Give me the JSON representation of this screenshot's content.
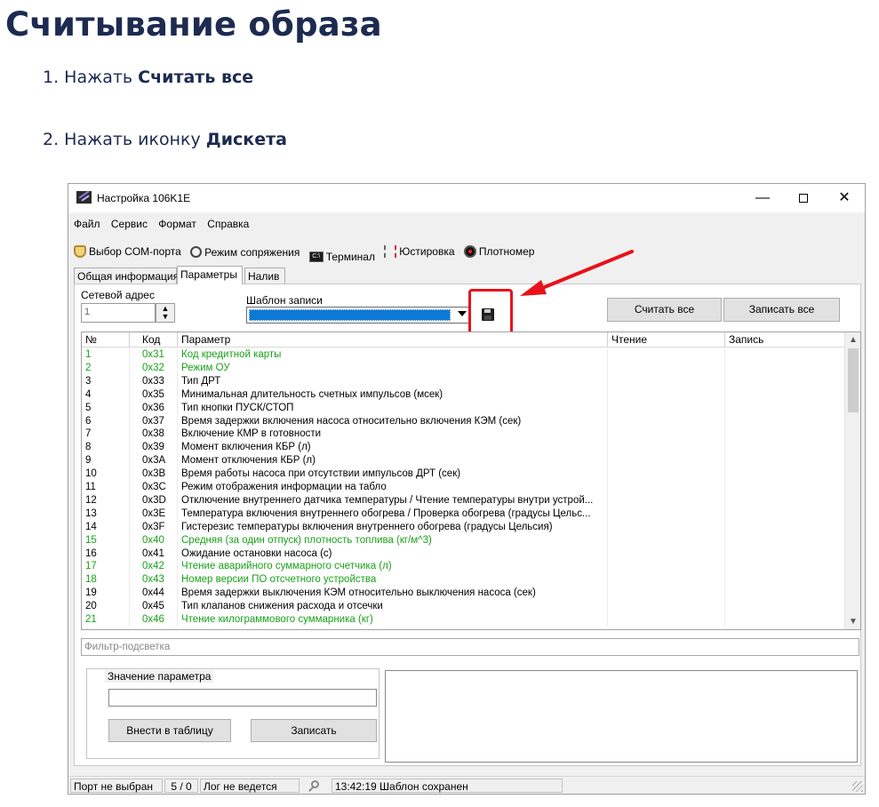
{
  "doc": {
    "title": "Считывание образа",
    "step1_text": "1. Нажать ",
    "step1_bold": "Считать все",
    "step2_text": "2. Нажать иконку ",
    "step2_bold": "Дискета"
  },
  "window": {
    "title": "Настройка 106K1E",
    "min": "—",
    "close": "✕"
  },
  "menu": [
    "Файл",
    "Сервис",
    "Формат",
    "Справка"
  ],
  "toolbar": {
    "com_port": "Выбор COM-порта",
    "pairing": "Режим сопряжения",
    "terminal": "Терминал",
    "calibration": "Юстировка",
    "densitometer": "Плотномер"
  },
  "tabs": [
    "Общая информация",
    "Параметры",
    "Налив"
  ],
  "params": {
    "net_addr_label": "Сетевой адрес",
    "net_addr_value": "1",
    "template_label": "Шаблон записи",
    "read_all": "Считать все",
    "write_all": "Записать все"
  },
  "table": {
    "columns": [
      "№",
      "Код",
      "Параметр",
      "Чтение",
      "Запись"
    ],
    "rows": [
      {
        "n": "1",
        "code": "0x31",
        "name": "Код кредитной карты",
        "green": true
      },
      {
        "n": "2",
        "code": "0x32",
        "name": "Режим ОУ",
        "green": true
      },
      {
        "n": "3",
        "code": "0x33",
        "name": "Тип ДРТ",
        "green": false
      },
      {
        "n": "4",
        "code": "0x35",
        "name": "Минимальная длительность счетных импульсов (мсек)",
        "green": false
      },
      {
        "n": "5",
        "code": "0x36",
        "name": "Тип кнопки ПУСК/СТОП",
        "green": false
      },
      {
        "n": "6",
        "code": "0x37",
        "name": "Время задержки включения насоса относительно включения КЭМ (сек)",
        "green": false
      },
      {
        "n": "7",
        "code": "0x38",
        "name": "Включение КМР в готовности",
        "green": false
      },
      {
        "n": "8",
        "code": "0x39",
        "name": "Момент включения КБР (л)",
        "green": false
      },
      {
        "n": "9",
        "code": "0x3A",
        "name": "Момент отключения КБР (л)",
        "green": false
      },
      {
        "n": "10",
        "code": "0x3B",
        "name": "Время работы насоса при отсутствии импульсов ДРТ (сек)",
        "green": false
      },
      {
        "n": "11",
        "code": "0x3C",
        "name": "Режим отображения информации на табло",
        "green": false
      },
      {
        "n": "12",
        "code": "0x3D",
        "name": "Отключение внутреннего датчика температуры / Чтение температуры внутри устрой...",
        "green": false
      },
      {
        "n": "13",
        "code": "0x3E",
        "name": "Температура включения внутреннего обогрева / Проверка обогрева (градусы Цельс...",
        "green": false
      },
      {
        "n": "14",
        "code": "0x3F",
        "name": "Гистерезис температуры включения внутреннего обогрева (градусы Цельсия)",
        "green": false
      },
      {
        "n": "15",
        "code": "0x40",
        "name": "Средняя (за один отпуск) плотность топлива (кг/м^3)",
        "green": true
      },
      {
        "n": "16",
        "code": "0x41",
        "name": "Ожидание остановки насоса (с)",
        "green": false
      },
      {
        "n": "17",
        "code": "0x42",
        "name": "Чтение аварийного суммарного счетчика (л)",
        "green": true
      },
      {
        "n": "18",
        "code": "0x43",
        "name": "Номер версии ПО отсчетного устройства",
        "green": true
      },
      {
        "n": "19",
        "code": "0x44",
        "name": "Время задержки выключения КЭМ относительно выключения насоса (сек)",
        "green": false
      },
      {
        "n": "20",
        "code": "0x45",
        "name": "Тип клапанов снижения расхода и отсечки",
        "green": false
      },
      {
        "n": "21",
        "code": "0x46",
        "name": "Чтение килограммового суммарника (кг)",
        "green": true
      }
    ]
  },
  "filter_placeholder": "Фильтр-подсветка",
  "value_group": {
    "title": "Значение параметра",
    "apply": "Внести в таблицу",
    "save": "Записать"
  },
  "status": {
    "port": "Порт не выбран",
    "counter": "5 / 0",
    "log": "Лог не ведется",
    "message": "13:42:19 Шаблон сохранен"
  },
  "colors": {
    "green_text": "#19a219",
    "highlight_red": "#e8121a",
    "selection_blue": "#0e78d6"
  }
}
